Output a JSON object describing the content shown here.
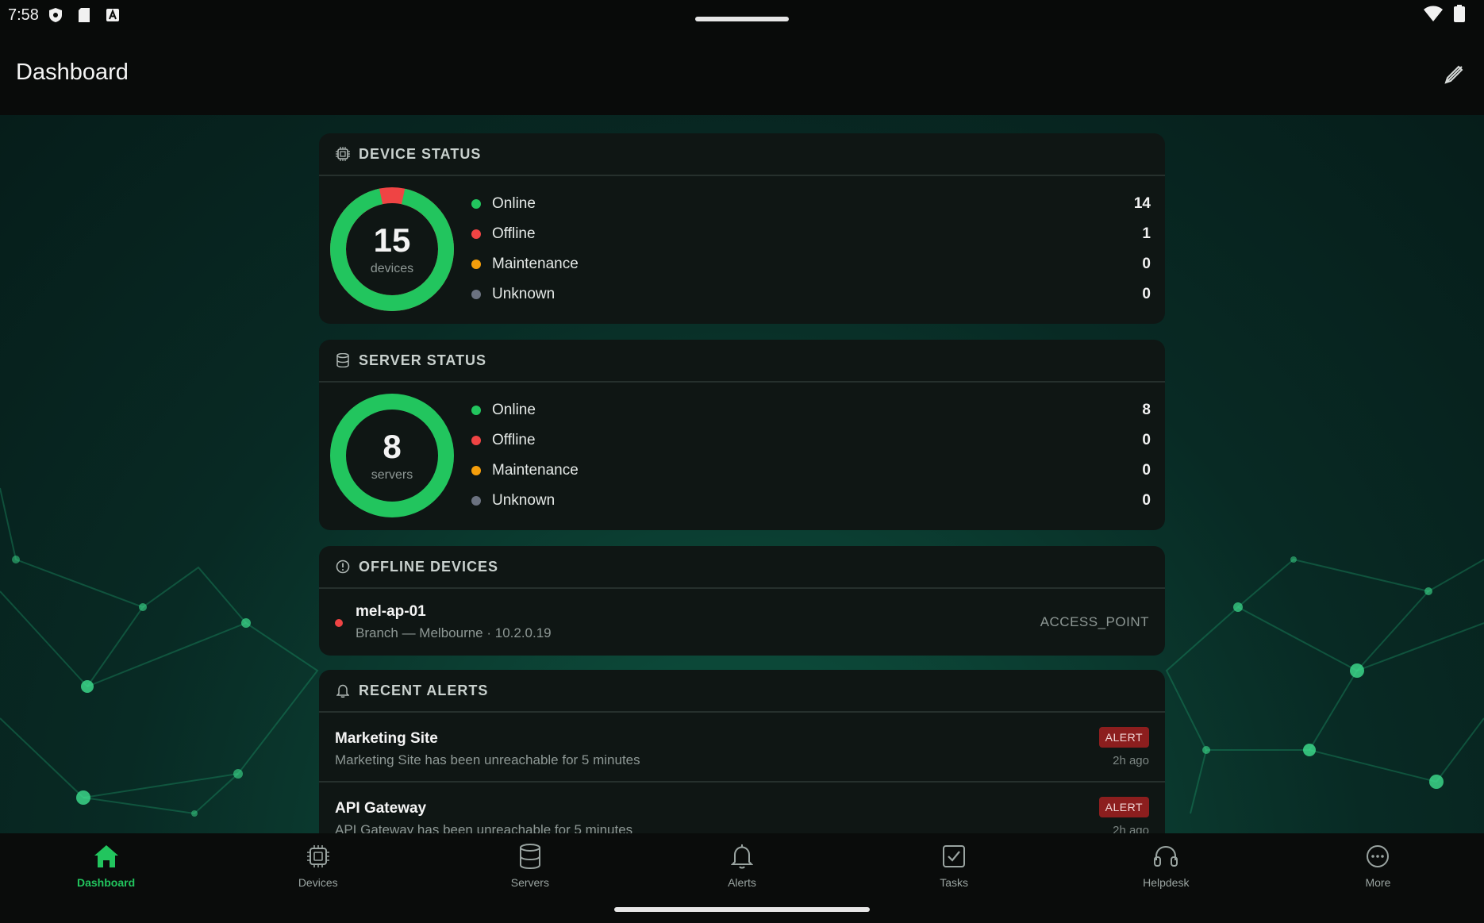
{
  "status_bar": {
    "time": "7:58"
  },
  "app_bar": {
    "title": "Dashboard"
  },
  "device_status": {
    "header": "DEVICE STATUS",
    "total": "15",
    "unit": "devices",
    "online_fraction": 0.9333,
    "items": [
      {
        "label": "Online",
        "value": "14",
        "color": "#22c55e"
      },
      {
        "label": "Offline",
        "value": "1",
        "color": "#ef4444"
      },
      {
        "label": "Maintenance",
        "value": "0",
        "color": "#f59e0b"
      },
      {
        "label": "Unknown",
        "value": "0",
        "color": "#6b7280"
      }
    ]
  },
  "server_status": {
    "header": "SERVER STATUS",
    "total": "8",
    "unit": "servers",
    "online_fraction": 1.0,
    "items": [
      {
        "label": "Online",
        "value": "8",
        "color": "#22c55e"
      },
      {
        "label": "Offline",
        "value": "0",
        "color": "#ef4444"
      },
      {
        "label": "Maintenance",
        "value": "0",
        "color": "#f59e0b"
      },
      {
        "label": "Unknown",
        "value": "0",
        "color": "#6b7280"
      }
    ]
  },
  "offline_devices": {
    "header": "OFFLINE DEVICES",
    "items": [
      {
        "name": "mel-ap-01",
        "meta": "Branch — Melbourne · 10.2.0.19",
        "type": "ACCESS_POINT"
      }
    ]
  },
  "recent_alerts": {
    "header": "RECENT ALERTS",
    "items": [
      {
        "title": "Marketing Site",
        "message": "Marketing Site has been unreachable for 5 minutes",
        "badge": "ALERT",
        "ago": "2h ago"
      },
      {
        "title": "API Gateway",
        "message": "API Gateway has been unreachable for 5 minutes",
        "badge": "ALERT",
        "ago": "2h ago"
      }
    ]
  },
  "bottom_nav": {
    "items": [
      {
        "label": "Dashboard",
        "icon": "home-icon",
        "active": true
      },
      {
        "label": "Devices",
        "icon": "chip-icon",
        "active": false
      },
      {
        "label": "Servers",
        "icon": "database-icon",
        "active": false
      },
      {
        "label": "Alerts",
        "icon": "bell-icon",
        "active": false
      },
      {
        "label": "Tasks",
        "icon": "checkbox-icon",
        "active": false
      },
      {
        "label": "Helpdesk",
        "icon": "headset-icon",
        "active": false
      },
      {
        "label": "More",
        "icon": "more-icon",
        "active": false
      }
    ]
  },
  "colors": {
    "accent": "#22c55e",
    "offline": "#ef4444",
    "card_bg": "#0f1614",
    "alert_badge": "#8c1e1e"
  }
}
